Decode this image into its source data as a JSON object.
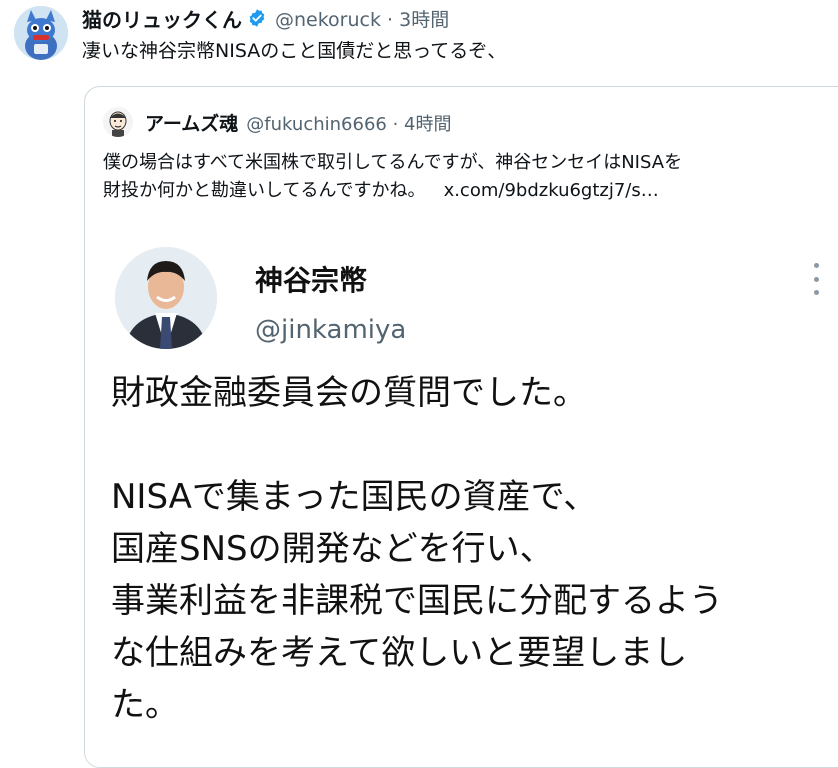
{
  "tweet": {
    "author_name": "猫のリュックくん",
    "handle_time": "@nekoruck · 3時間",
    "text": "凄いな神谷宗幣NISAのこと国債だと思ってるぞ、",
    "verified_icon": "verified-badge-icon",
    "accent": "#1d9bf0"
  },
  "quote": {
    "author_name": "アームズ魂",
    "handle_time": "@fukuchin6666 · 4時間",
    "lines": [
      "僕の場合はすべて米国株で取引してるんですが、神谷センセイはNISAを",
      "財投か何かと勘違いしてるんですかね。"
    ],
    "link": "x.com/9bdzku6gtzj7/s…",
    "image": {
      "name": "神谷宗幣",
      "handle": "@jinkamiya",
      "lines": [
        "財政金融委員会の質問でした。",
        "",
        "NISAで集まった国民の資産で、",
        "国産SNSの開発などを行い、",
        "事業利益を非課税で国民に分配するよう",
        "な仕組みを考えて欲しいと要望しまし",
        "た。"
      ]
    }
  }
}
